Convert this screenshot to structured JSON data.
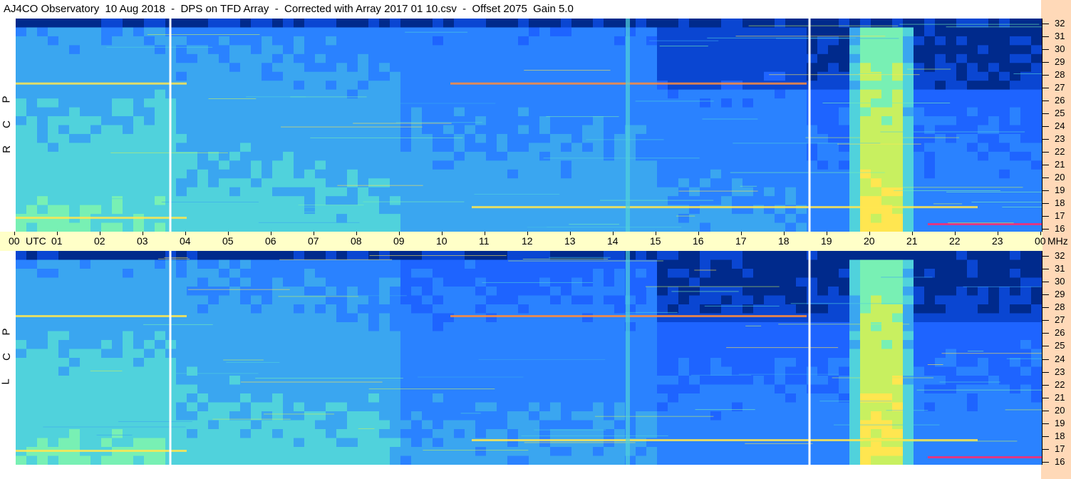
{
  "title": "AJ4CO Observatory  10 Aug 2018  -  DPS on TFD Array  -  Corrected with Array 2017 01 10.csv  -  Offset 2075  Gain 5.0",
  "time_axis": {
    "utc_label": "UTC",
    "mhz_label": "MHz",
    "ticks": [
      "00",
      "01",
      "02",
      "03",
      "04",
      "05",
      "06",
      "07",
      "08",
      "09",
      "10",
      "11",
      "12",
      "13",
      "14",
      "15",
      "16",
      "17",
      "18",
      "19",
      "20",
      "21",
      "22",
      "23",
      "00"
    ]
  },
  "panels": [
    {
      "id": "rcp",
      "side_letters": [
        "P",
        "C",
        "R"
      ]
    },
    {
      "id": "lcp",
      "side_letters": [
        "P",
        "C",
        "L"
      ]
    }
  ],
  "freq_ticks": [
    "32",
    "31",
    "30",
    "29",
    "28",
    "27",
    "26",
    "25",
    "24",
    "23",
    "22",
    "21",
    "20",
    "19",
    "18",
    "17",
    "16"
  ],
  "chart_data": {
    "type": "heatmap",
    "title": "AJ4CO Observatory  10 Aug 2018  -  DPS on TFD Array  -  Corrected with Array 2017 01 10.csv  -  Offset 2075  Gain 5.0",
    "xlabel": "UTC",
    "ylabel": "MHz",
    "x_range_hours": [
      0,
      24
    ],
    "y_range_mhz": [
      16,
      32
    ],
    "panels": [
      "RCP",
      "LCP"
    ],
    "colors": {
      "low": "#000a3c",
      "mid": "#1e64ff",
      "high": "#50e6d2",
      "peak": "#ffe650",
      "max": "#ff2a6e"
    }
  }
}
